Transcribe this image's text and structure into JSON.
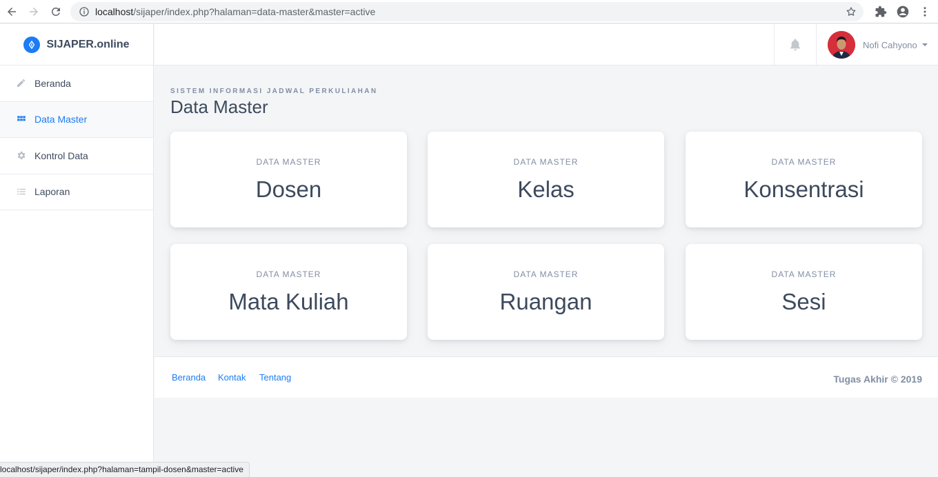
{
  "browser": {
    "url_host": "localhost",
    "url_path": "/sijaper/index.php?halaman=data-master&master=active"
  },
  "sidebar": {
    "brand": "SIJAPER.online",
    "items": [
      {
        "label": "Beranda",
        "icon": "pencil-icon"
      },
      {
        "label": "Data Master",
        "icon": "grid-icon",
        "active": true
      },
      {
        "label": "Kontrol Data",
        "icon": "gear-icon"
      },
      {
        "label": "Laporan",
        "icon": "list-icon"
      }
    ]
  },
  "header": {
    "user_name": "Nofi Cahyono"
  },
  "page": {
    "subtitle": "Sistem Informasi Jadwal Perkuliahan",
    "title": "Data Master"
  },
  "cards": [
    {
      "label": "DATA MASTER",
      "value": "Dosen"
    },
    {
      "label": "DATA MASTER",
      "value": "Kelas"
    },
    {
      "label": "DATA MASTER",
      "value": "Konsentrasi"
    },
    {
      "label": "DATA MASTER",
      "value": "Mata Kuliah"
    },
    {
      "label": "DATA MASTER",
      "value": "Ruangan"
    },
    {
      "label": "DATA MASTER",
      "value": "Sesi"
    }
  ],
  "footer": {
    "links": [
      "Beranda",
      "Kontak",
      "Tentang"
    ],
    "copyright": "Tugas Akhir © 2019"
  },
  "status_url": "localhost/sijaper/index.php?halaman=tampil-dosen&master=active",
  "colors": {
    "accent": "#1b7cf4",
    "text": "#3d4a5d",
    "muted": "#818ea3",
    "background": "#f4f5f7"
  }
}
